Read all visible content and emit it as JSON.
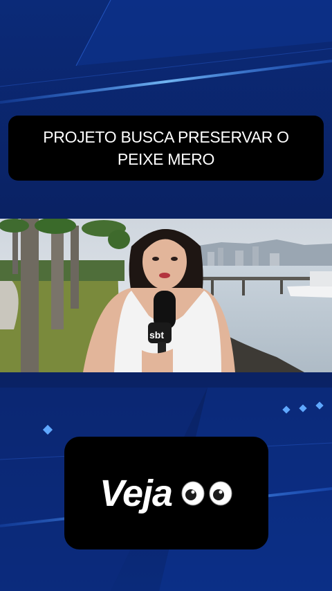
{
  "headline": {
    "text": "PROJETO BUSCA PRESERVAR O PEIXE MERO"
  },
  "video": {
    "mic_logo": "sbt"
  },
  "cta": {
    "label": "Veja",
    "emoji_icon": "eyes-icon"
  },
  "colors": {
    "background": "#0a1f5c",
    "accent_line": "#4aa3ff",
    "box": "#000000"
  }
}
